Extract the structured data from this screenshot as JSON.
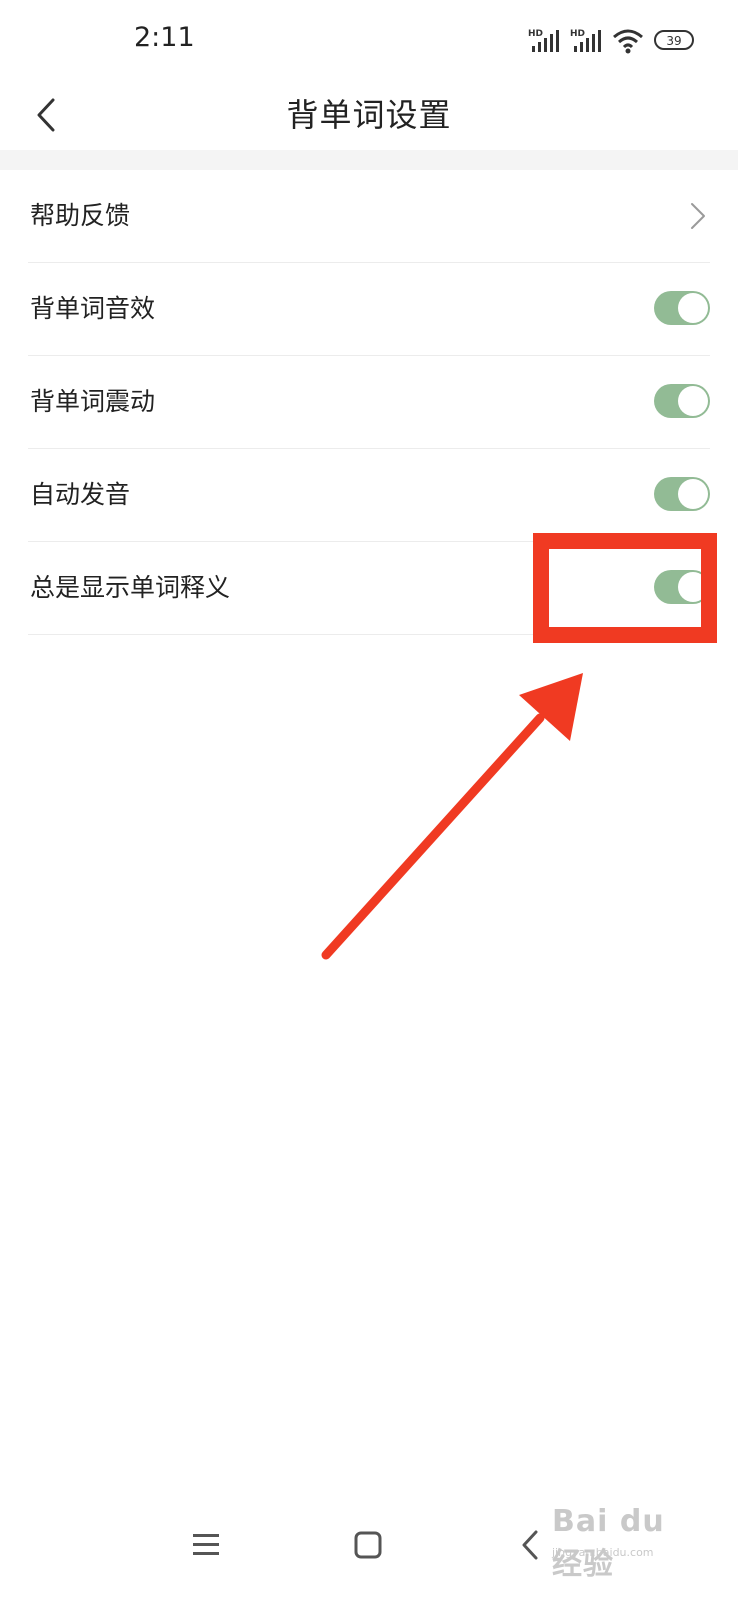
{
  "status_bar": {
    "time": "2:11",
    "battery": "39",
    "icons": [
      "hd-signal-icon",
      "hd-signal-icon",
      "wifi-icon",
      "battery-icon"
    ]
  },
  "header": {
    "title": "背单词设置",
    "back_icon": "chevron-left-icon"
  },
  "settings": [
    {
      "label": "帮助反馈",
      "control": "chevron"
    },
    {
      "label": "背单词音效",
      "control": "toggle",
      "on": true
    },
    {
      "label": "背单词震动",
      "control": "toggle",
      "on": true
    },
    {
      "label": "自动发音",
      "control": "toggle",
      "on": true
    },
    {
      "label": "总是显示单词释义",
      "control": "toggle",
      "on": true
    }
  ],
  "colors": {
    "toggle_on": "#92bb95",
    "annotation": "#f03a22",
    "divider": "#ececec"
  },
  "system_nav": {
    "menu_icon": "menu-icon",
    "home_icon": "square-home-icon",
    "back_icon": "back-triangle-icon"
  },
  "watermark": {
    "logo": "Bai du 经验",
    "url": "jingyan.baidu.com"
  }
}
